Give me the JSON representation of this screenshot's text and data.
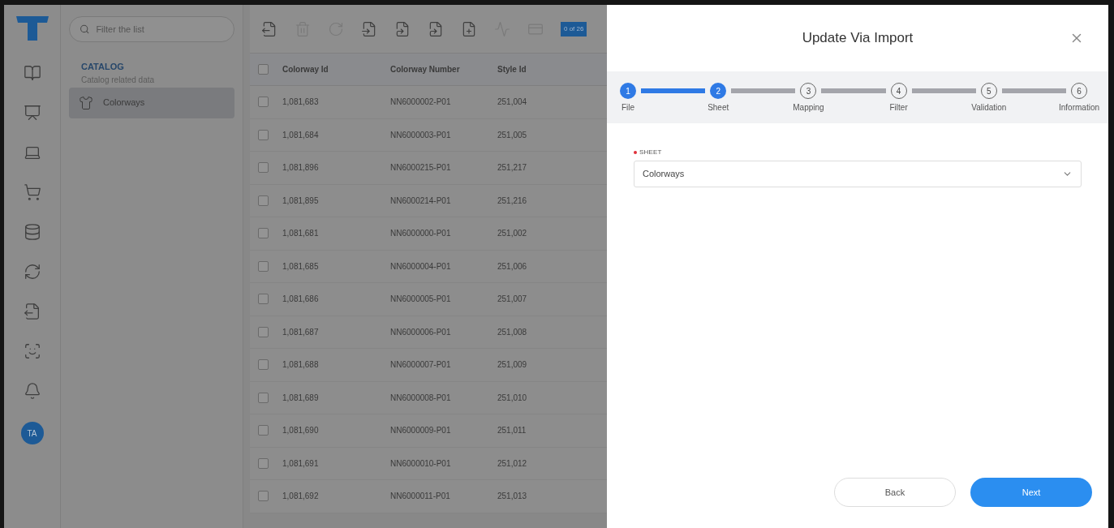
{
  "search": {
    "placeholder": "Filter the list"
  },
  "catalog": {
    "title": "CATALOG",
    "subtitle": "Catalog related data",
    "items": [
      {
        "label": "Colorways",
        "selected": true
      }
    ]
  },
  "toolbar": {
    "count_badge": "0 of 26"
  },
  "table": {
    "header_checked": false,
    "columns": [
      "Colorway Id",
      "Colorway Number",
      "Style Id"
    ],
    "rows": [
      {
        "checked": false,
        "cells": [
          "1,081,683",
          "NN6000002-P01",
          "251,004"
        ]
      },
      {
        "checked": false,
        "cells": [
          "1,081,684",
          "NN6000003-P01",
          "251,005"
        ]
      },
      {
        "checked": false,
        "cells": [
          "1,081,896",
          "NN6000215-P01",
          "251,217"
        ]
      },
      {
        "checked": false,
        "cells": [
          "1,081,895",
          "NN6000214-P01",
          "251,216"
        ]
      },
      {
        "checked": false,
        "cells": [
          "1,081,681",
          "NN6000000-P01",
          "251,002"
        ]
      },
      {
        "checked": false,
        "cells": [
          "1,081,685",
          "NN6000004-P01",
          "251,006"
        ]
      },
      {
        "checked": false,
        "cells": [
          "1,081,686",
          "NN6000005-P01",
          "251,007"
        ]
      },
      {
        "checked": false,
        "cells": [
          "1,081,687",
          "NN6000006-P01",
          "251,008"
        ]
      },
      {
        "checked": false,
        "cells": [
          "1,081,688",
          "NN6000007-P01",
          "251,009"
        ]
      },
      {
        "checked": false,
        "cells": [
          "1,081,689",
          "NN6000008-P01",
          "251,010"
        ]
      },
      {
        "checked": false,
        "cells": [
          "1,081,690",
          "NN6000009-P01",
          "251,011"
        ]
      },
      {
        "checked": false,
        "cells": [
          "1,081,691",
          "NN6000010-P01",
          "251,012"
        ]
      },
      {
        "checked": false,
        "cells": [
          "1,081,692",
          "NN6000011-P01",
          "251,013"
        ]
      }
    ]
  },
  "user": {
    "initials": "TA"
  },
  "dialog": {
    "title": "Update Via Import",
    "steps": [
      {
        "number": "1",
        "label": "File",
        "reached": true
      },
      {
        "number": "2",
        "label": "Sheet",
        "reached": true
      },
      {
        "number": "3",
        "label": "Mapping",
        "reached": false
      },
      {
        "number": "4",
        "label": "Filter",
        "reached": false
      },
      {
        "number": "5",
        "label": "Validation",
        "reached": false
      },
      {
        "number": "6",
        "label": "Information",
        "reached": false
      }
    ],
    "field": {
      "label": "SHEET",
      "required": true,
      "value": "Colorways"
    },
    "buttons": {
      "back": "Back",
      "next": "Next"
    }
  }
}
